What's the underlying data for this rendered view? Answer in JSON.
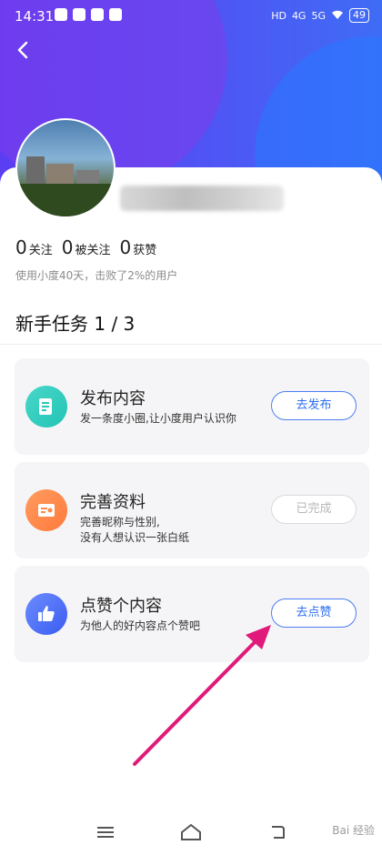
{
  "status_bar": {
    "time": "14:31",
    "network_label": "4G",
    "network_label_2": "5G",
    "hd_label": "HD",
    "battery": "49"
  },
  "header": {
    "back_icon": "chevron-left-icon"
  },
  "profile": {
    "stats": [
      {
        "value": "0",
        "label": "关注"
      },
      {
        "value": "0",
        "label": "被关注"
      },
      {
        "value": "0",
        "label": "获赞"
      }
    ],
    "usage_text": "使用小度40天，击败了2%的用户"
  },
  "tasks_section": {
    "title": "新手任务 1 / 3",
    "items": [
      {
        "title": "发布内容",
        "desc": "发一条度小圈,让小度用户认识你",
        "button": "去发布",
        "icon": "document-edit-icon",
        "done": false
      },
      {
        "title": "完善资料",
        "desc": "完善昵称与性别,\n没有人想认识一张白纸",
        "button": "已完成",
        "icon": "profile-card-icon",
        "done": true
      },
      {
        "title": "点赞个内容",
        "desc": "为他人的好内容点个赞吧",
        "button": "去点赞",
        "icon": "thumbs-up-icon",
        "done": false
      }
    ]
  },
  "colors": {
    "accent_blue": "#2f6ff0",
    "header_purple": "#5b3df2",
    "annotation_pink": "#e01a7a"
  },
  "watermark": "Bai 经验"
}
